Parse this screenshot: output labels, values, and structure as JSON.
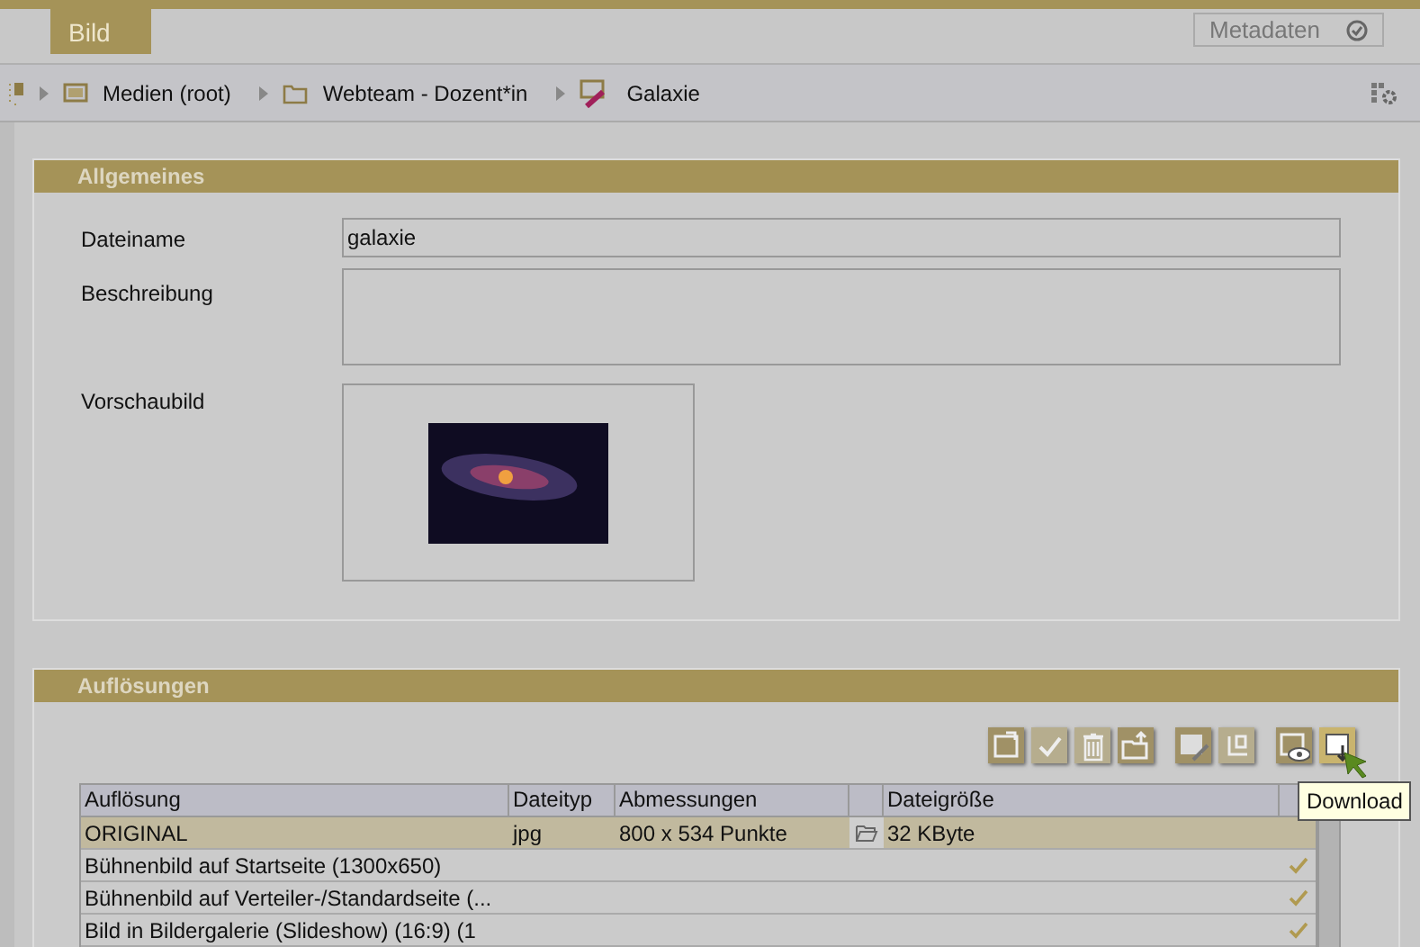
{
  "tabs": [
    {
      "label": "Bild",
      "selected": true
    }
  ],
  "metadata_button": {
    "label": "Metadaten"
  },
  "breadcrumb": [
    {
      "label": "Medien (root)",
      "kind": "root"
    },
    {
      "label": "Webteam - Dozent*in",
      "kind": "folder"
    },
    {
      "label": "Galaxie",
      "kind": "image"
    }
  ],
  "general": {
    "title": "Allgemeines",
    "fields": [
      {
        "label": "Dateiname",
        "value": "galaxie",
        "kind": "text"
      },
      {
        "label": "Beschreibung",
        "kind": "textarea"
      },
      {
        "label": "Vorschaubild",
        "kind": "preview"
      }
    ]
  },
  "resolutions": {
    "title": "Auflösungen",
    "toolbar": [
      {
        "disabled": false
      },
      {
        "disabled": true
      },
      {
        "disabled": true
      },
      {
        "disabled": false
      },
      {
        "disabled": false
      },
      {
        "disabled": true
      },
      {
        "disabled": false
      },
      {
        "disabled": false,
        "tooltip": "Download"
      }
    ],
    "columns": [
      "Auflösung",
      "Dateityp",
      "Abmessungen",
      "Dateigröße"
    ],
    "rows": [
      {
        "name": "ORIGINAL",
        "type": "jpg",
        "size": "800 x 534 Punkte",
        "filesize": "32 KByte",
        "selected": true,
        "done": false
      },
      {
        "name": "Bühnenbild auf Startseite (1300x650)",
        "selected": false,
        "done": true
      },
      {
        "name": "Bühnenbild auf Verteiler-/Standardseite (...",
        "selected": false,
        "done": true
      },
      {
        "name": "Bild in Bildergalerie (Slideshow) (16:9) (1",
        "selected": false,
        "done": true
      }
    ]
  }
}
